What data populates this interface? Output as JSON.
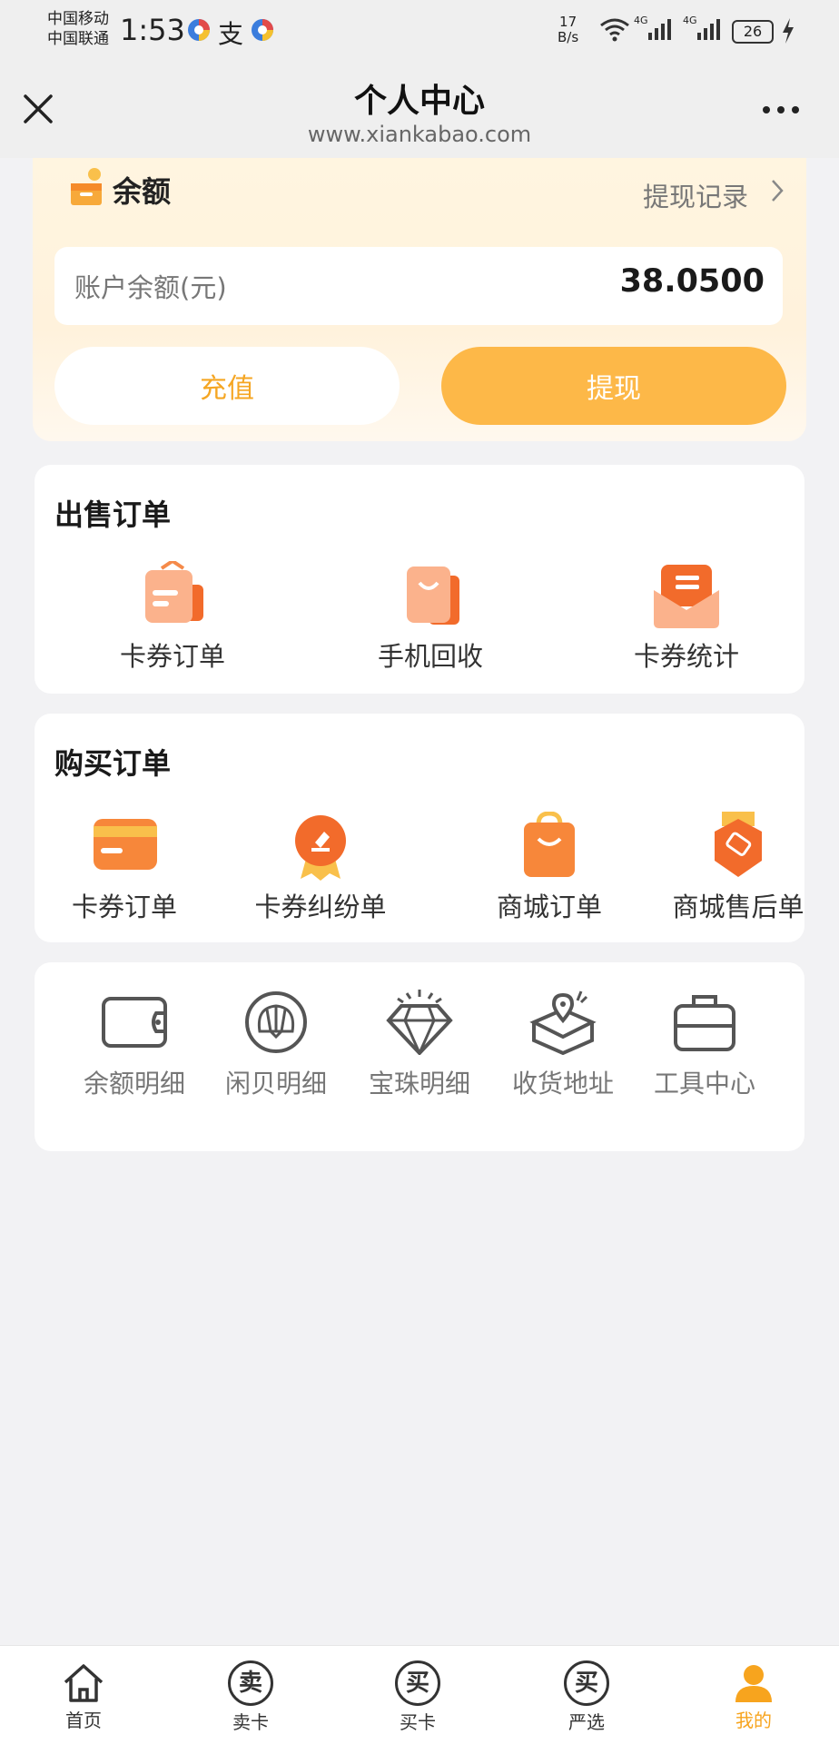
{
  "status_bar": {
    "carrier_1": "中国移动",
    "carrier_2": "中国联通",
    "time": "1:53",
    "app_char": "支",
    "speed_value": "17",
    "speed_unit": "B/s",
    "network_1": "4G",
    "network_2": "4G",
    "battery": "26"
  },
  "nav": {
    "title": "个人中心",
    "subtitle": "www.xiankabao.com"
  },
  "balance": {
    "title": "余额",
    "record_link": "提现记录",
    "account_label": "账户余额(元)",
    "amount": "38.0500",
    "recharge_label": "充值",
    "withdraw_label": "提现"
  },
  "sell_orders": {
    "title": "出售订单",
    "items": [
      {
        "label": "卡券订单"
      },
      {
        "label": "手机回收"
      },
      {
        "label": "卡券统计"
      }
    ]
  },
  "buy_orders": {
    "title": "购买订单",
    "items": [
      {
        "label": "卡券订单"
      },
      {
        "label": "卡券纠纷单"
      },
      {
        "label": "商城订单"
      },
      {
        "label": "商城售后单"
      }
    ]
  },
  "tools": {
    "items": [
      {
        "label": "余额明细"
      },
      {
        "label": "闲贝明细"
      },
      {
        "label": "宝珠明细"
      },
      {
        "label": "收货地址"
      },
      {
        "label": "工具中心"
      }
    ]
  },
  "tabbar": {
    "items": [
      {
        "label": "首页",
        "glyph": ""
      },
      {
        "label": "卖卡",
        "glyph": "卖"
      },
      {
        "label": "买卡",
        "glyph": "买"
      },
      {
        "label": "严选",
        "glyph": "买"
      },
      {
        "label": "我的",
        "glyph": ""
      }
    ],
    "active_color": "#f7a41e"
  },
  "colors": {
    "accent": "#fdb848",
    "accent_text": "#f5a623",
    "icon_orange": "#f7873a"
  }
}
